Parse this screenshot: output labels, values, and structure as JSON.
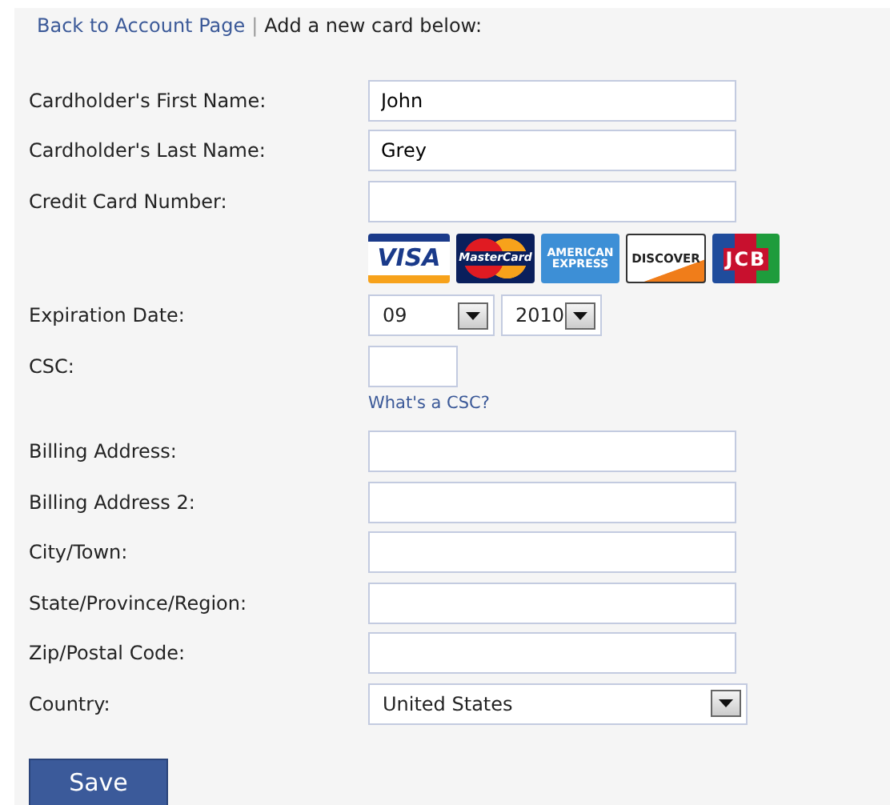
{
  "header": {
    "back_link": "Back to Account Page",
    "separator": "|",
    "instruction": "Add a new card below:"
  },
  "rows": [
    {
      "kind": "input",
      "label": "Cardholder's First Name:",
      "value": "John"
    },
    {
      "kind": "input",
      "label": "Cardholder's Last Name:",
      "value": "Grey"
    },
    {
      "kind": "input",
      "label": "Credit Card Number:"
    },
    {
      "kind": "logos",
      "logos": [
        {
          "kind": "visa",
          "text": "VISA"
        },
        {
          "kind": "mastercard",
          "text": "MasterCard"
        },
        {
          "kind": "amex",
          "text": "AMERICAN EXPRESS"
        },
        {
          "kind": "discover",
          "text": "DISCOVER"
        },
        {
          "kind": "jcb",
          "text": "JCB"
        }
      ]
    },
    {
      "kind": "selects",
      "label": "Expiration Date:",
      "selects": [
        {
          "value": "09"
        },
        {
          "value": "2010"
        }
      ]
    },
    {
      "kind": "short",
      "label": "CSC:"
    },
    {
      "kind": "link",
      "text": "What's a CSC?"
    },
    {
      "kind": "input",
      "label": "Billing Address:"
    },
    {
      "kind": "input",
      "label": "Billing Address 2:"
    },
    {
      "kind": "input",
      "label": "City/Town:"
    },
    {
      "kind": "input",
      "label": "State/Province/Region:"
    },
    {
      "kind": "input",
      "label": "Zip/Postal Code:"
    },
    {
      "kind": "wide-select",
      "label": "Country:",
      "value": "United States"
    }
  ],
  "save_button": "Save"
}
